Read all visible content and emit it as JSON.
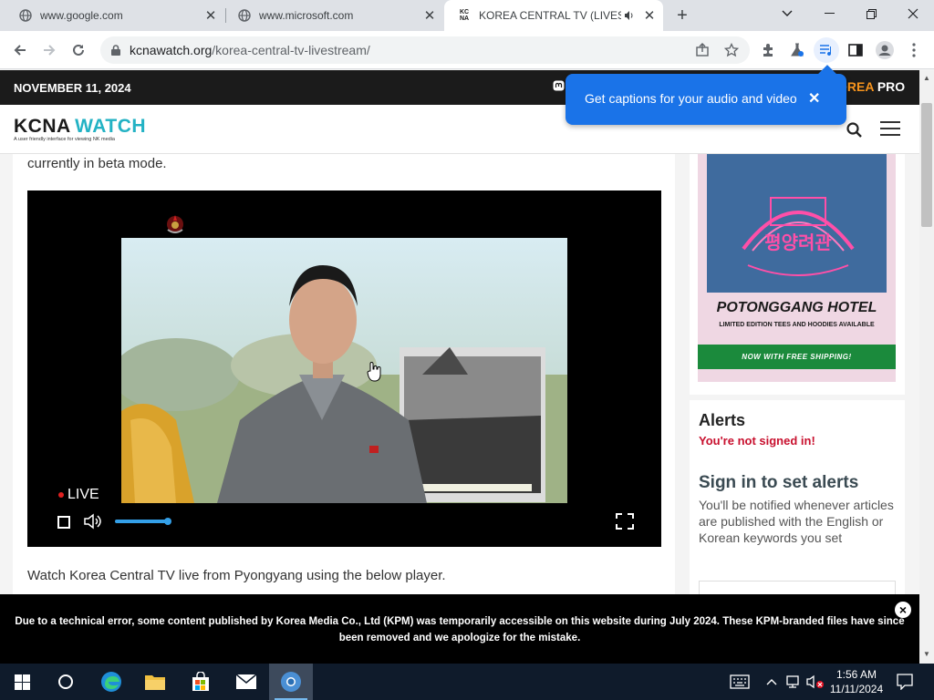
{
  "browser": {
    "tabs": [
      {
        "title": "www.google.com",
        "active": false
      },
      {
        "title": "www.microsoft.com",
        "active": false
      },
      {
        "title": "KOREA CENTRAL TV (LIVEST",
        "active": true
      }
    ],
    "new_tab_label": "+",
    "window_controls": [
      "chevron-down-icon",
      "minimize-icon",
      "restore-icon",
      "close-icon"
    ],
    "url_host": "kcnawatch.org",
    "url_path": "/korea-central-tv-livestream/",
    "caption_popup": "Get captions for your audio and video"
  },
  "site": {
    "date": "NOVEMBER 11, 2024",
    "pro_orange": "OREA",
    "pro_white": " PRO",
    "logo_kcna": "KCNA",
    "logo_watch": "WATCH",
    "logo_tagline": "A user friendly interface for viewing NK media",
    "beta_text": "currently in beta mode.",
    "live_label": "LIVE",
    "volume_level": 0.9,
    "watch_text": "Watch Korea Central TV live from Pyongyang using the below player."
  },
  "ad": {
    "title": "POTONGGANG HOTEL",
    "subtitle": "LIMITED EDITION TEES AND HOODIES AVAILABLE",
    "shipping": "NOW WITH FREE SHIPPING!"
  },
  "alerts": {
    "title": "Alerts",
    "not_signed_in": "You're not signed in!",
    "sign_in_title": "Sign in to set alerts",
    "description": "You'll be notified whenever articles are published with the English or Korean keywords you set"
  },
  "banner": {
    "message": "Due to a technical error, some content published by Korea Media Co., Ltd (KPM) was temporarily accessible on this website during July 2024. These KPM-branded files have since been removed and we apologize for the mistake.",
    "close": "×"
  },
  "taskbar": {
    "time": "1:56 AM",
    "date": "11/11/2024"
  },
  "colors": {
    "accent": "#1a73e8",
    "logo_teal": "#23b2c4",
    "alert_red": "#c8102e",
    "ship_green": "#1b8a3c"
  }
}
